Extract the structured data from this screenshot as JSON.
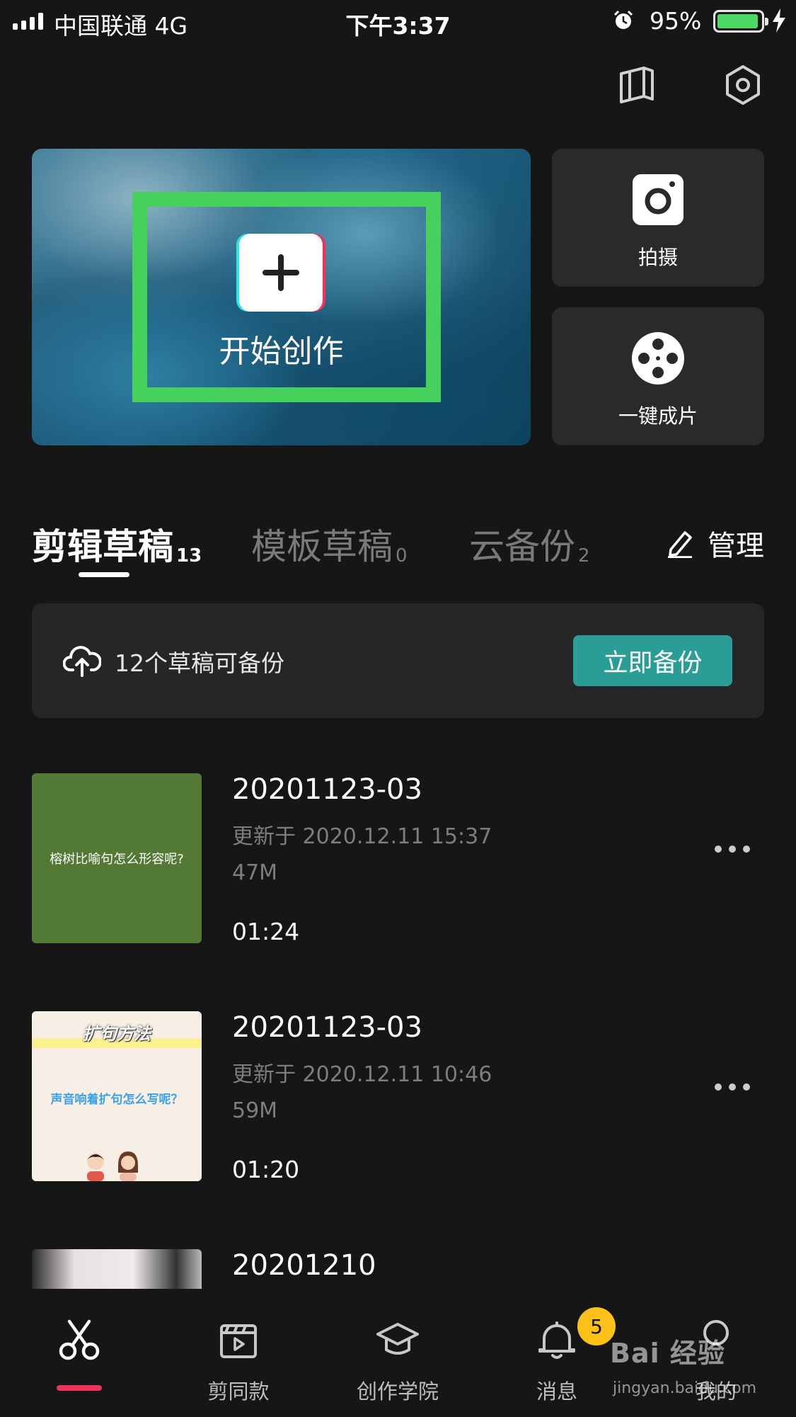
{
  "status_bar": {
    "carrier": "中国联通   4G",
    "time": "下午3:37",
    "battery_percent": "95%",
    "battery_level": 0.95,
    "battery_color": "#4cd964"
  },
  "top_icons": [
    "book-icon",
    "settings-icon"
  ],
  "hero": {
    "label": "开始创作",
    "highlight_color": "#46d15d"
  },
  "side_cards": [
    {
      "label": "拍摄",
      "icon": "camera-icon"
    },
    {
      "label": "一键成片",
      "icon": "film-reel-icon"
    }
  ],
  "tabs": [
    {
      "label": "剪辑草稿",
      "count": "13",
      "active": true
    },
    {
      "label": "模板草稿",
      "count": "0",
      "active": false
    },
    {
      "label": "云备份",
      "count": "2",
      "active": false
    }
  ],
  "manage_label": "管理",
  "backup": {
    "text": "12个草稿可备份",
    "button": "立即备份",
    "button_color": "#2a9d96"
  },
  "drafts": [
    {
      "title": "20201123-03",
      "updated": "更新于 2020.12.11 15:37",
      "size": "47M",
      "duration": "01:24",
      "thumb_text": "榕树比喻句怎么形容呢?"
    },
    {
      "title": "20201123-03",
      "updated": "更新于 2020.12.11 10:46",
      "size": "59M",
      "duration": "01:20",
      "thumb_title": "扩句方法",
      "thumb_text": "声音响着扩句怎么写呢？"
    },
    {
      "title": "20201210"
    }
  ],
  "bottom_nav": [
    {
      "label": "",
      "icon": "scissors-icon",
      "active": true
    },
    {
      "label": "剪同款",
      "icon": "clapperboard-icon"
    },
    {
      "label": "创作学院",
      "icon": "graduation-cap-icon"
    },
    {
      "label": "消息",
      "icon": "bell-icon",
      "badge": "5"
    },
    {
      "label": "我的",
      "icon": "profile-icon"
    }
  ],
  "accent_color": "#f0325a",
  "watermark": {
    "main": "Bai 经验",
    "sub": "jingyan.baidu.com"
  }
}
